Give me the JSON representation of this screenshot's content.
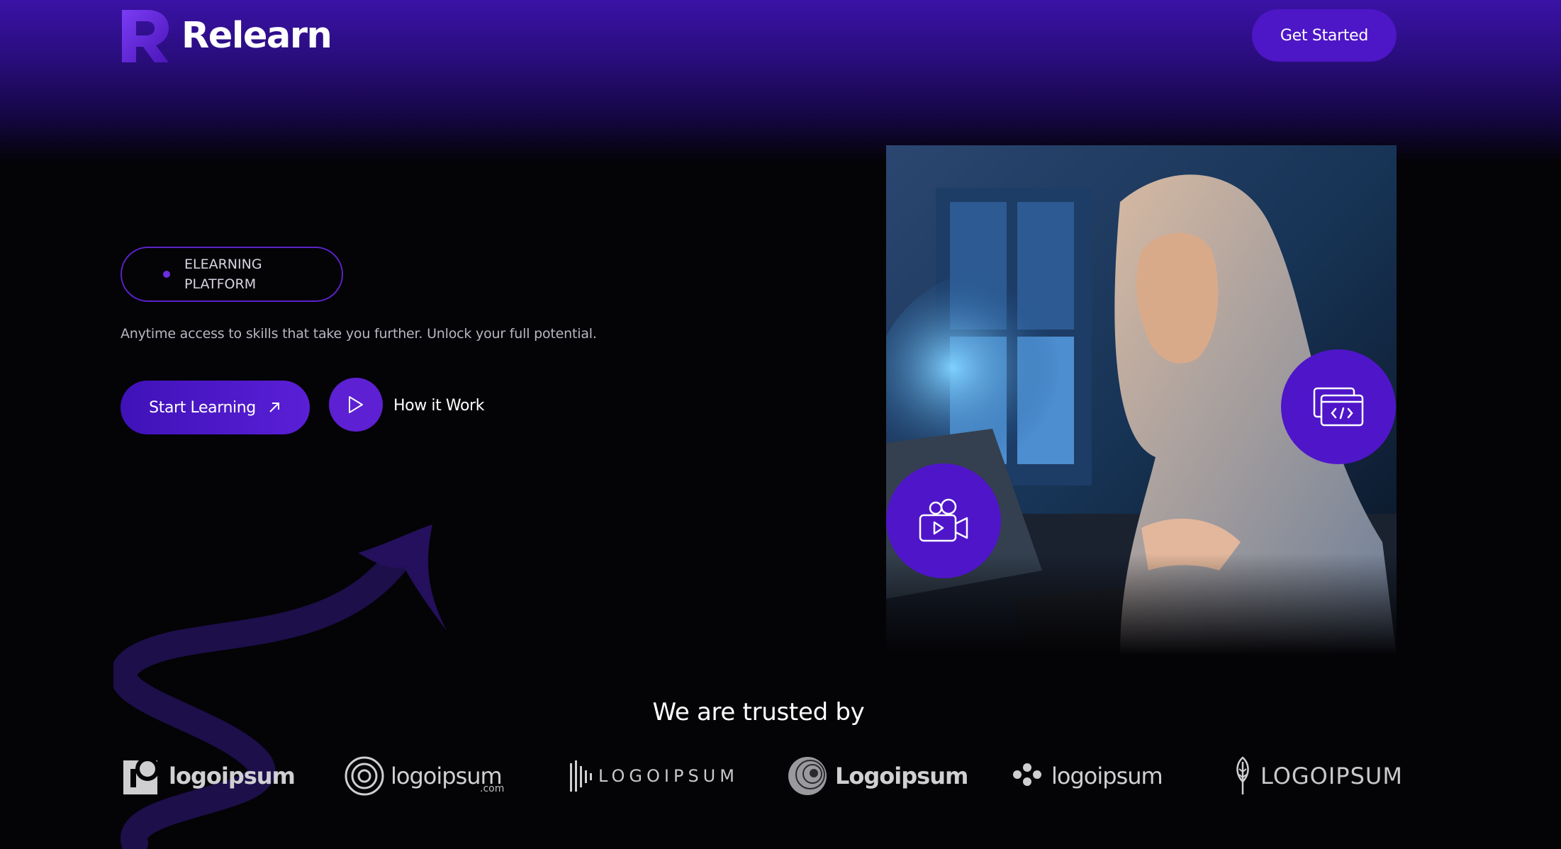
{
  "header": {
    "brand": "Relearn",
    "cta_label": "Get Started"
  },
  "hero": {
    "badge_label": "ELEARNING PLATFORM",
    "tagline": "Anytime access to skills that take you further. Unlock your full potential.",
    "primary_label": "Start Learning",
    "secondary_label": "How it Work"
  },
  "trusted": {
    "title": "We are trusted by",
    "logos": [
      "logoipsum",
      "logoipsum",
      "LOGOIPSUM",
      "Logoipsum",
      "logoipsum",
      "LOGOIPSUM"
    ],
    "logo2_suffix": ".com"
  },
  "icons": [
    "logo-mark-icon",
    "arrow-up-right-icon",
    "play-icon",
    "code-window-icon",
    "video-camera-icon"
  ],
  "colors": {
    "accent": "#4f15c9",
    "background": "#040306",
    "header_glow": "#3a12a6"
  }
}
